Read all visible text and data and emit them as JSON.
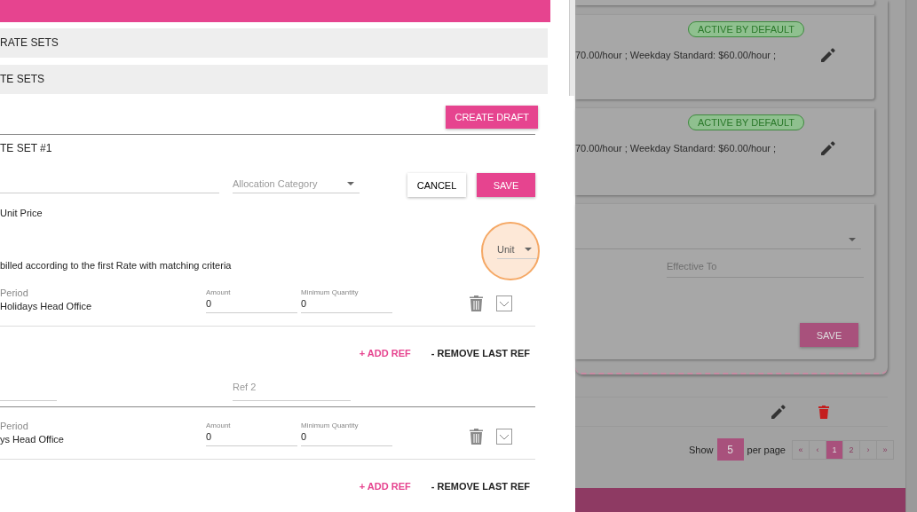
{
  "drawer": {
    "sections": [
      {
        "label": "RATE SETS"
      },
      {
        "label": "TE SETS"
      }
    ],
    "create_draft_button": "CREATE DRAFT",
    "rate_set": {
      "title": "TE SET #1",
      "allocation_category": {
        "placeholder": "Allocation Category"
      },
      "cancel_button": "CANCEL",
      "save_button": "SAVE",
      "pricing_label": "Unit Price",
      "unit_select": {
        "placeholder": "Unit"
      },
      "rule_text": "billed according to the first Rate with matching criteria",
      "rates": [
        {
          "period_label": "Period",
          "period": "Holidays Head Office",
          "amount_label": "Amount",
          "amount": "0",
          "min_qty_label": "Minimum Quantity",
          "min_qty": "0",
          "add_ref": "+ ADD REF",
          "remove_ref": "- REMOVE LAST REF",
          "refs": [
            {
              "kind": "field"
            },
            {
              "kind": "field",
              "placeholder": "Ref 2"
            }
          ]
        },
        {
          "period_label": "Period",
          "period": "ys Head Office",
          "amount_label": "Amount",
          "amount": "0",
          "min_qty_label": "Minimum Quantity",
          "min_qty": "0",
          "add_ref": "+ ADD REF",
          "remove_ref": "- REMOVE LAST REF"
        }
      ]
    }
  },
  "background_page": {
    "cards": [
      {
        "badge": "ACTIVE BY DEFAULT",
        "summary": "70.00/hour ; Weekday Standard: $60.00/hour ;"
      },
      {
        "badge": "ACTIVE BY DEFAULT",
        "summary": "70.00/hour ; Weekday Standard: $60.00/hour ;"
      }
    ],
    "edit_form": {
      "effective_to": {
        "placeholder": "Effective To"
      },
      "save_button": "SAVE"
    },
    "pagination": {
      "show_label": "Show",
      "per_page": "5",
      "per_page_label": "per page",
      "pages": [
        {
          "label": "«",
          "selected": false
        },
        {
          "label": "‹",
          "selected": false
        },
        {
          "label": "1",
          "selected": true
        },
        {
          "label": "2",
          "selected": false
        },
        {
          "label": "›",
          "selected": false
        },
        {
          "label": "»",
          "selected": false
        }
      ]
    }
  }
}
